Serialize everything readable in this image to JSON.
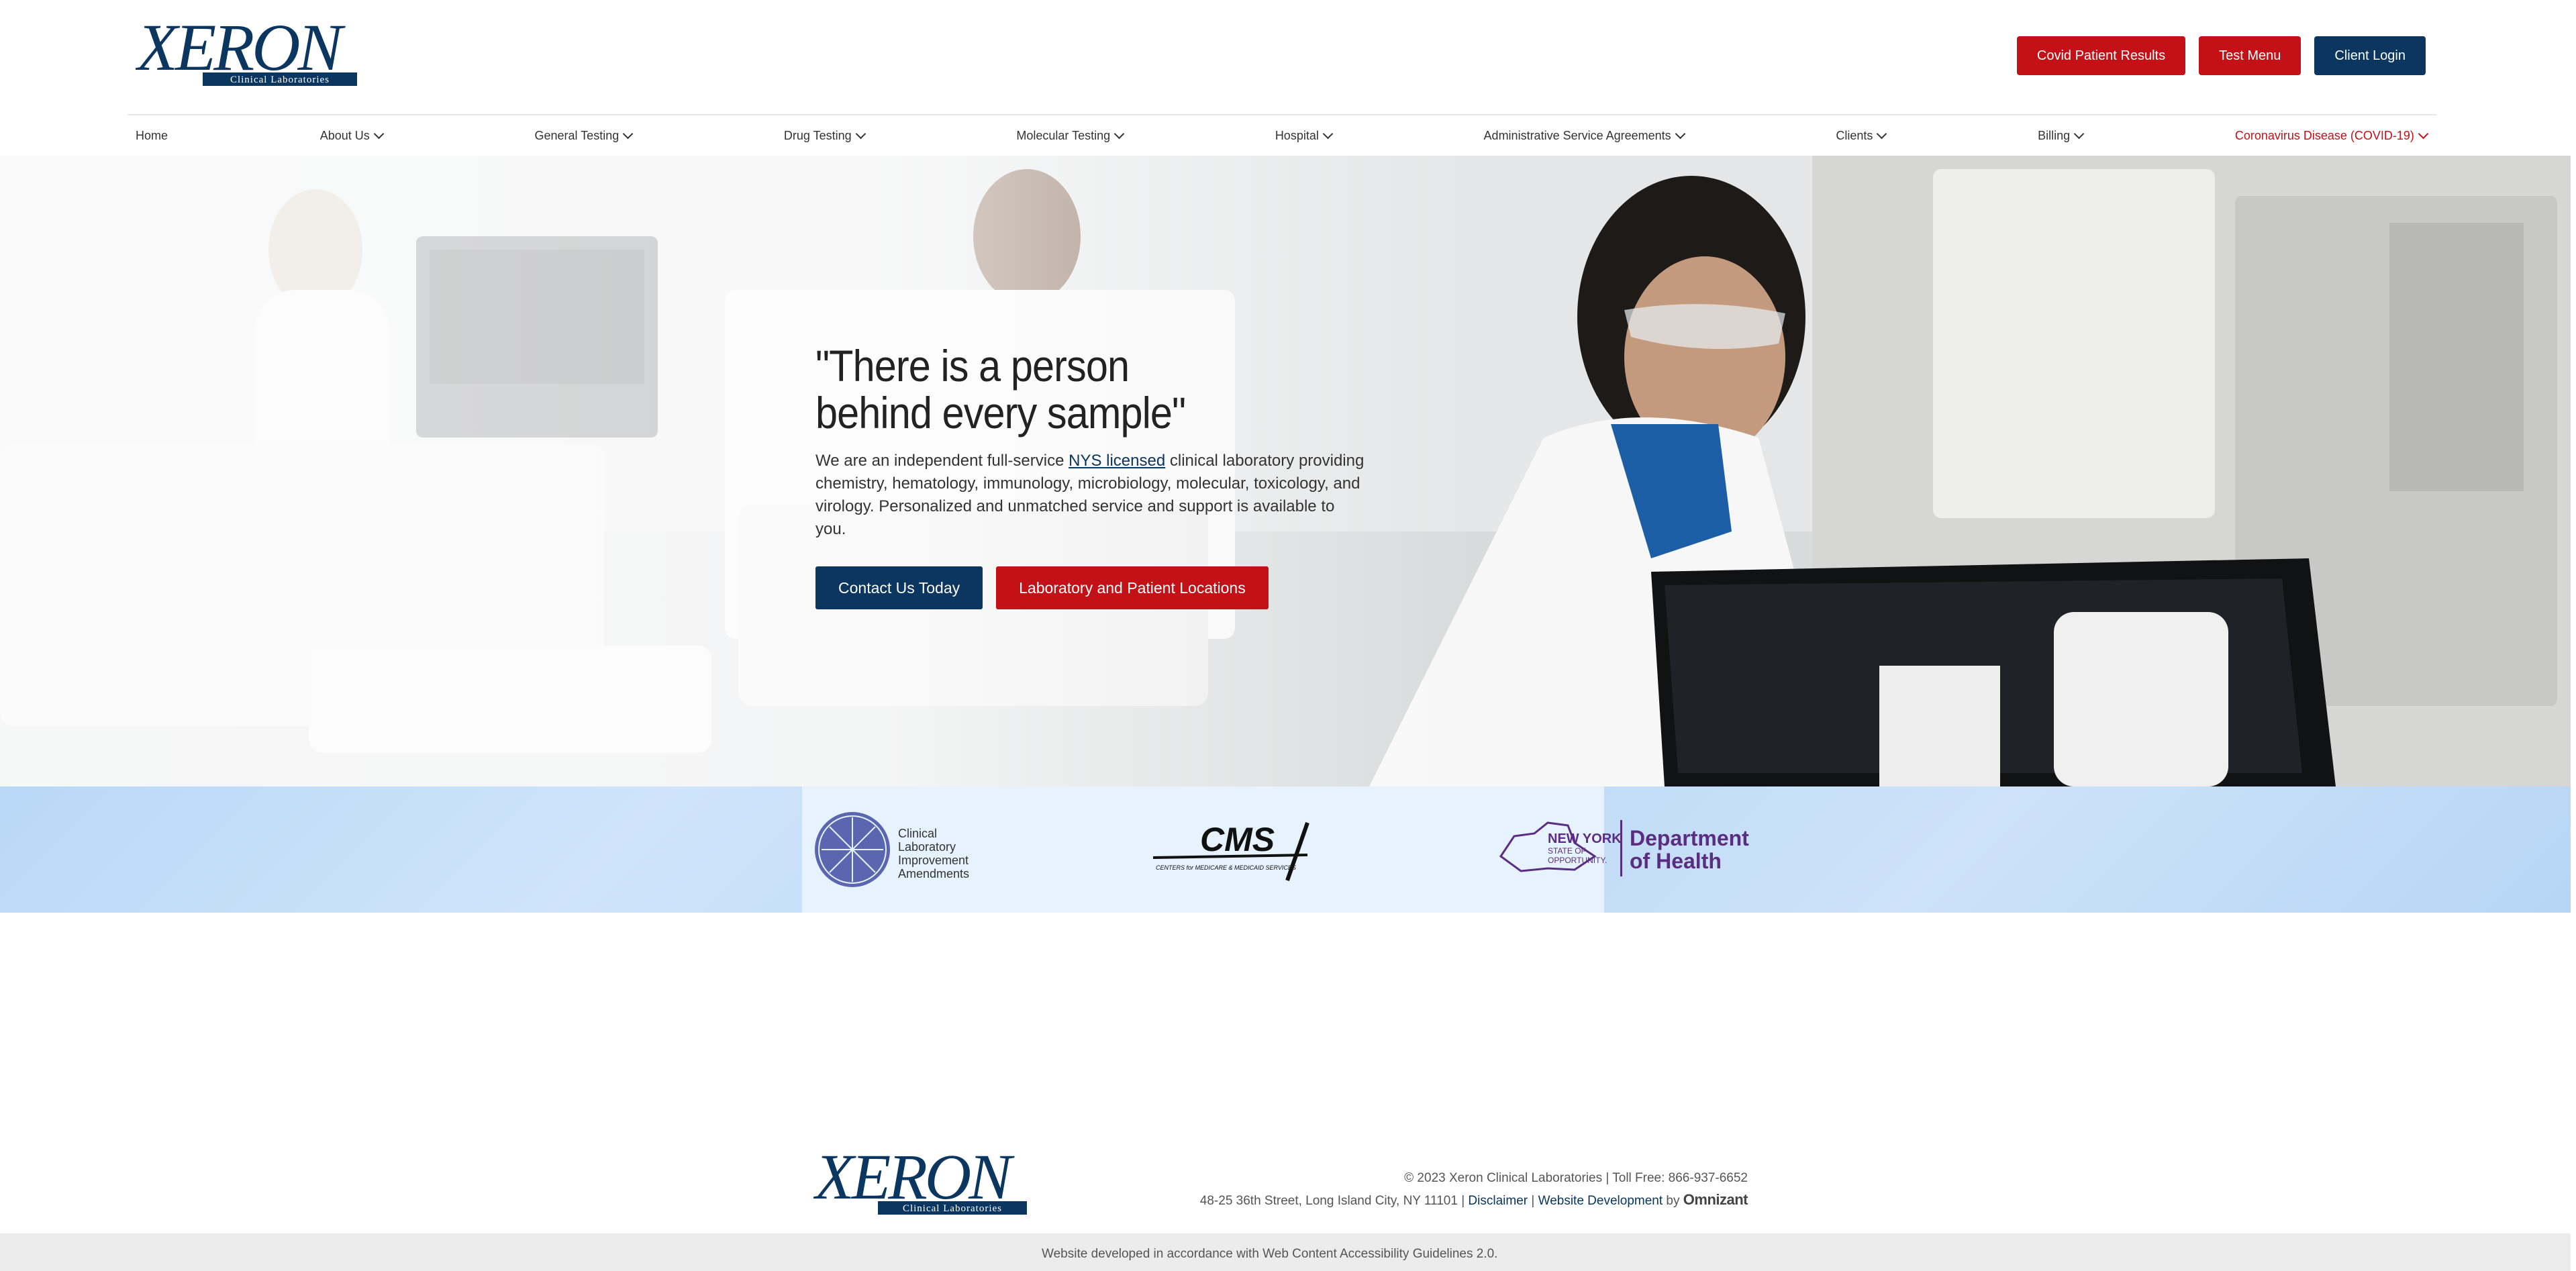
{
  "brand": {
    "logo_text": "XERON",
    "logo_subtext": "Clinical Laboratories"
  },
  "header": {
    "buttons": [
      {
        "label": "Covid Patient Results"
      },
      {
        "label": "Test Menu"
      },
      {
        "label": "Client Login"
      }
    ]
  },
  "nav": {
    "items": [
      {
        "label": "Home"
      },
      {
        "label": "About Us"
      },
      {
        "label": "General Testing"
      },
      {
        "label": "Drug Testing"
      },
      {
        "label": "Molecular Testing"
      },
      {
        "label": "Hospital"
      },
      {
        "label": "Administrative Service Agreements"
      },
      {
        "label": "Clients"
      },
      {
        "label": "Billing"
      },
      {
        "label": "Coronavirus Disease (COVID-19)"
      }
    ]
  },
  "hero": {
    "title_line1": "\"There is a person",
    "title_line2": "behind every sample\"",
    "text_before": "We are an independent full-service ",
    "link": "NYS licensed",
    "text_after": " clinical laboratory providing chemistry, hematology, immunology, microbiology, molecular, toxicology, and virology. Personalized and unmatched service and support is available to you.",
    "cta_primary": "Contact Us Today",
    "cta_secondary": "Laboratory and Patient Locations"
  },
  "accreditations": {
    "clia": [
      "Clinical",
      "Laboratory",
      "Improvement",
      "Amendments"
    ],
    "cms": "CMS",
    "cms_sub": "CENTERS for MEDICARE & MEDICAID SERVICES",
    "nys": [
      "NEW YORK",
      "STATE OF",
      "OPPORTUNITY."
    ],
    "doh": [
      "Department",
      "of Health"
    ]
  },
  "footer": {
    "copyright": "© 2023 Xeron Clinical Laboratories | Toll Free: 866-937-6652",
    "address": "48-25 36th Street, Long Island City, NY 11101 | ",
    "disclaimer": "Disclaimer",
    "separator": " | ",
    "webdev": "Website Development",
    "by": " by ",
    "agency": "Omnizant",
    "accessibility": "Website developed in accordance with Web Content Accessibility Guidelines 2.0."
  },
  "colors": {
    "navy": "#0b3660",
    "red": "#c41017"
  }
}
